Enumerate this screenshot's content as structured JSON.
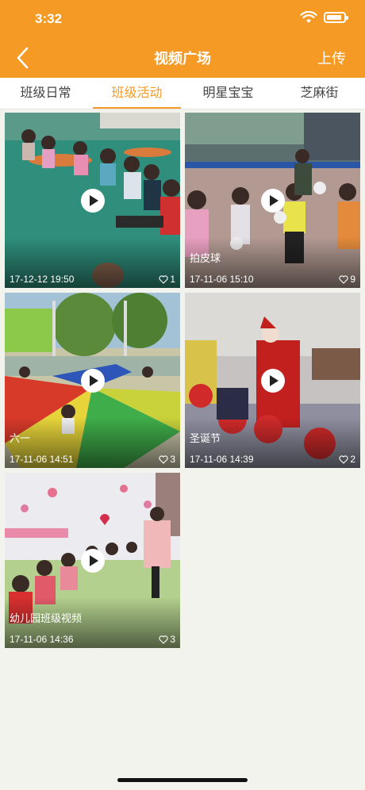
{
  "status": {
    "time": "3:32"
  },
  "header": {
    "title": "视频广场",
    "upload": "上传"
  },
  "tabs": [
    {
      "label": "班级日常",
      "active": false
    },
    {
      "label": "班级活动",
      "active": true
    },
    {
      "label": "明星宝宝",
      "active": false
    },
    {
      "label": "芝麻街",
      "active": false
    }
  ],
  "videos": [
    {
      "caption": "",
      "date": "17-12-12 19:50",
      "likes": "1"
    },
    {
      "caption": "拍皮球",
      "date": "17-11-06 15:10",
      "likes": "9"
    },
    {
      "caption": "六一",
      "date": "17-11-06 14:51",
      "likes": "3"
    },
    {
      "caption": "圣诞节",
      "date": "17-11-06 14:39",
      "likes": "2"
    },
    {
      "caption": "幼儿园班级视频",
      "date": "17-11-06 14:36",
      "likes": "3"
    }
  ],
  "colors": {
    "accent": "#f59a24",
    "background": "#f3f3ee"
  },
  "icons": {
    "back": "chevron-left-icon",
    "play": "play-icon",
    "like": "heart-outline-icon"
  }
}
